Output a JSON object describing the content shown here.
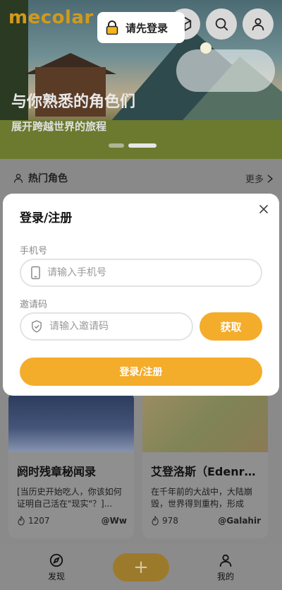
{
  "app": {
    "logo": "mecolar"
  },
  "colors": {
    "accent": "#f4ac2b",
    "logo": "#d29a1a",
    "modal_bg": "#ffffff"
  },
  "header": {
    "login_prompt": "请先登录",
    "icons": [
      "lock-icon",
      "cube-icon",
      "search-icon",
      "user-icon"
    ]
  },
  "hero": {
    "title": "与你熟悉的角色们",
    "subtitle": "展开跨越世界的旅程",
    "carousel_count": 2,
    "carousel_active": 1
  },
  "section": {
    "title": "热门角色",
    "more": "更多"
  },
  "cards": [
    {
      "title": "阏时残章秘闻录",
      "desc": "[当历史开始吃人，你该如何证明自己活在\"现实\"？]...",
      "likes": "1207",
      "author": "@Ww"
    },
    {
      "title": "艾登洛斯（Edenros...",
      "desc": "在千年前的大战中，大陆崩毁，世界得到重构，形成了...",
      "likes": "978",
      "author": "@Galahir"
    }
  ],
  "tabbar": {
    "discover": "发现",
    "mine": "我的",
    "plus": "+"
  },
  "modal": {
    "title": "登录/注册",
    "phone_label": "手机号",
    "phone_placeholder": "请输入手机号",
    "code_label": "邀请码",
    "code_placeholder": "请输入邀请码",
    "get_button": "获取",
    "submit_button": "登录/注册"
  }
}
